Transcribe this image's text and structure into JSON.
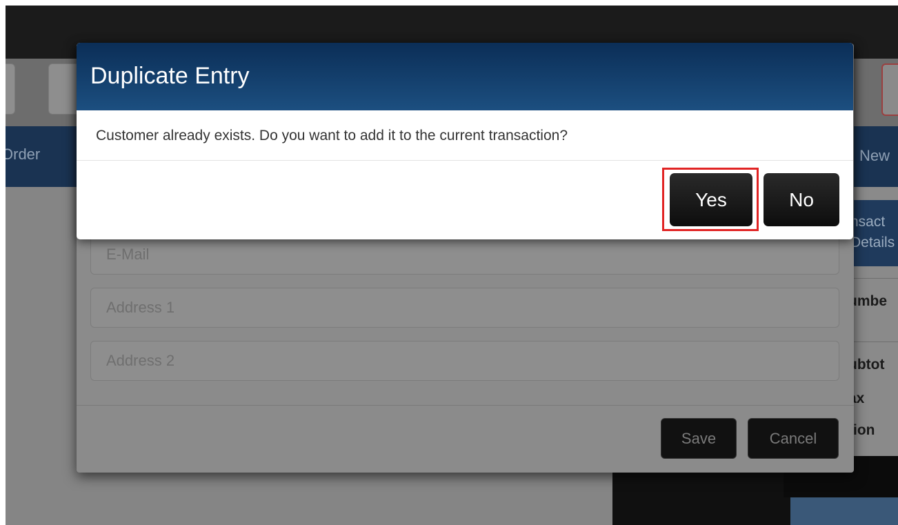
{
  "background": {
    "nav_left_text": "Order",
    "nav_right_text": "New",
    "right_panel": {
      "header_line1": "nsact",
      "header_line2": "Details",
      "rows": [
        "umbe",
        "ubtot",
        "ax",
        "tion"
      ]
    }
  },
  "customer_form": {
    "fields": [
      {
        "placeholder": "E-Mail"
      },
      {
        "placeholder": "Address 1"
      },
      {
        "placeholder": "Address 2"
      }
    ],
    "save_label": "Save",
    "cancel_label": "Cancel"
  },
  "dialog": {
    "title": "Duplicate Entry",
    "message": "Customer already exists. Do you want to add it to the current transaction?",
    "yes_label": "Yes",
    "no_label": "No",
    "header_gradient": [
      "#0b2e57",
      "#1c4f80"
    ],
    "highlight_color": "#e12424"
  }
}
